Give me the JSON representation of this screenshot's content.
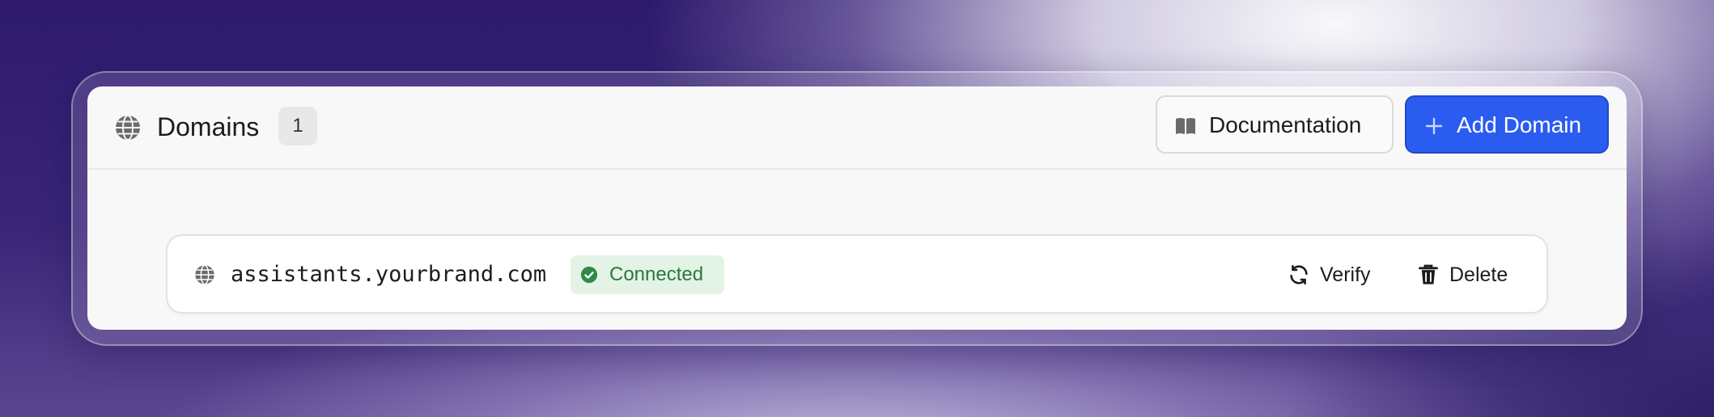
{
  "header": {
    "title": "Domains",
    "count": "1",
    "title_icon": "globe-icon"
  },
  "toolbar": {
    "documentation_label": "Documentation",
    "documentation_icon": "book-open-icon",
    "add_domain_label": "Add Domain",
    "add_domain_icon": "plus-icon"
  },
  "domains": [
    {
      "name": "assistants.yourbrand.com",
      "icon": "globe-icon",
      "status": "Connected",
      "status_icon": "check-circle-icon",
      "actions": [
        {
          "label": "Verify",
          "icon": "refresh-icon"
        },
        {
          "label": "Delete",
          "icon": "trash-icon"
        }
      ]
    }
  ],
  "colors": {
    "accent": "#2b5cf0",
    "status_connected_bg": "#e3f3e6",
    "status_connected_text": "#277a3a",
    "background_dark": "#2d1a6c"
  }
}
